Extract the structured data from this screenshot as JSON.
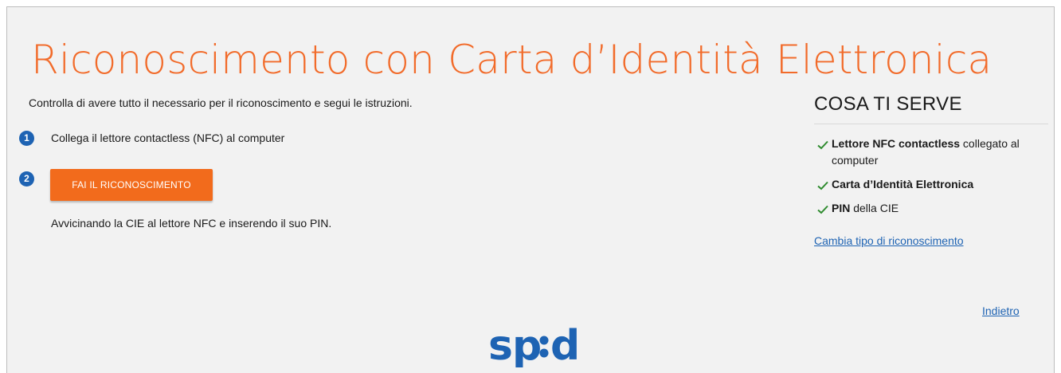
{
  "page": {
    "title": "Riconoscimento con Carta d’Identità Elettronica",
    "intro": "Controlla di avere tutto il necessario per il riconoscimento e segui le istruzioni."
  },
  "steps": [
    {
      "number": "1",
      "text": "Collega il lettore contactless (NFC) al computer"
    },
    {
      "number": "2",
      "button_label": "FAI IL RICONOSCIMENTO",
      "hint": "Avvicinando la CIE al lettore NFC e inserendo il suo PIN."
    }
  ],
  "requirements": {
    "title": "COSA TI SERVE",
    "items": [
      {
        "bold": "Lettore NFC contactless",
        "rest": " collegato al computer",
        "icon": "check-icon"
      },
      {
        "bold": "Carta d’Identità Elettronica",
        "rest": "",
        "icon": "check-icon"
      },
      {
        "bold": "PIN",
        "rest": " della CIE",
        "icon": "check-icon"
      }
    ],
    "change_link": "Cambia tipo di riconoscimento"
  },
  "nav": {
    "back_link": "Indietro"
  },
  "logo": {
    "text": "spid",
    "icon": "spid-logo"
  },
  "colors": {
    "accent": "#f26b2a",
    "button": "#f26b1c",
    "link": "#1e63b3",
    "check": "#2e8b2e",
    "background": "#f2f2f2"
  }
}
